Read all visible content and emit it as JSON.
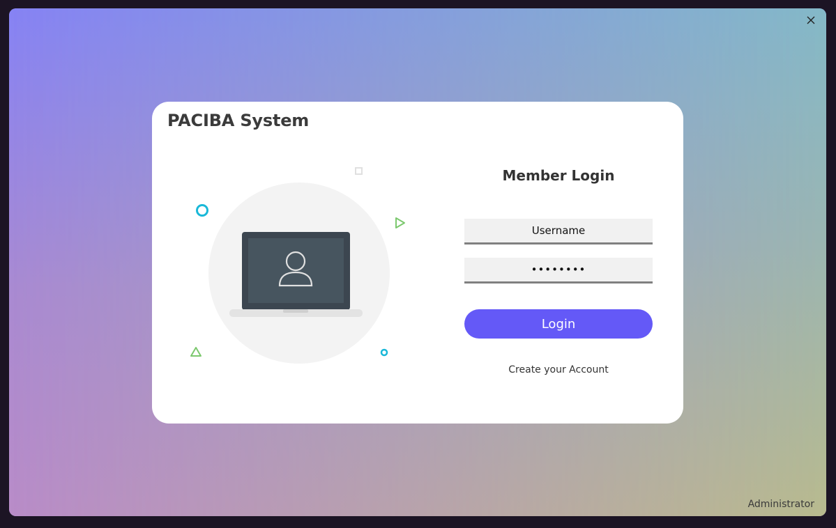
{
  "window": {
    "close_icon": "close-icon"
  },
  "card": {
    "app_title": "PACIBA System"
  },
  "illustration": {
    "icons": [
      "laptop-icon",
      "user-avatar-icon",
      "circle-shape",
      "square-shape",
      "play-triangle-shape",
      "triangle-shape"
    ],
    "colors": {
      "circle_bg": "#f3f3f3",
      "laptop_frame": "#3c4650",
      "laptop_screen": "#47555f",
      "accent_cyan": "#19b8d8",
      "accent_green": "#7cc86e"
    }
  },
  "login": {
    "heading": "Member Login",
    "username_placeholder": "Username",
    "password_value": "••••••••",
    "button_label": "Login",
    "create_account_label": "Create your Account"
  },
  "footer": {
    "role_label": "Administrator"
  },
  "colors": {
    "accent": "#6459f7",
    "card_bg": "#ffffff",
    "field_bg": "#f1f1f1",
    "field_border": "#808080"
  }
}
